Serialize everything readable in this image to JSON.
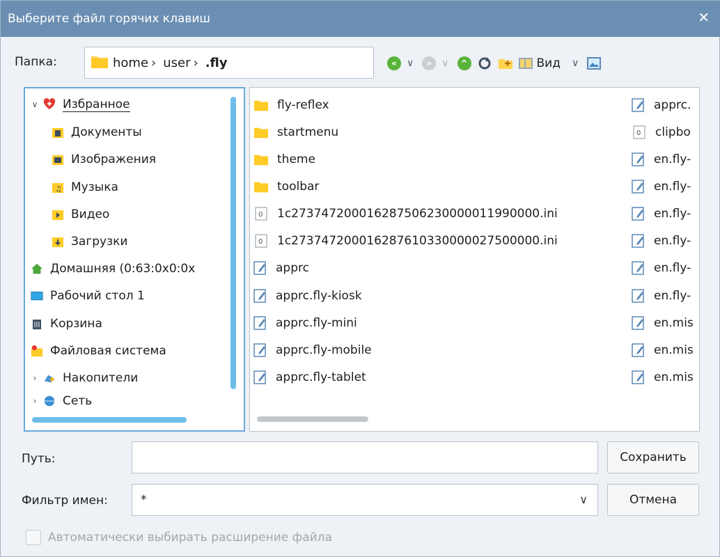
{
  "window": {
    "title": "Выберите файл горячих клавиш",
    "close_icon": "close-icon"
  },
  "location": {
    "label": "Папка:",
    "breadcrumbs": [
      "home",
      "user",
      ".fly"
    ]
  },
  "toolbar": {
    "view_label": "Вид"
  },
  "sidebar": {
    "items": [
      {
        "label": "Избранное"
      },
      {
        "label": "Документы"
      },
      {
        "label": "Изображения"
      },
      {
        "label": "Музыка"
      },
      {
        "label": "Видео"
      },
      {
        "label": "Загрузки"
      },
      {
        "label": "Домашняя (0:63:0x0:0x"
      },
      {
        "label": "Рабочий стол 1"
      },
      {
        "label": "Корзина"
      },
      {
        "label": "Файловая система"
      },
      {
        "label": "Накопители"
      },
      {
        "label": "Сеть"
      }
    ]
  },
  "files": {
    "col1": [
      {
        "name": "fly-reflex"
      },
      {
        "name": "startmenu"
      },
      {
        "name": "theme"
      },
      {
        "name": "toolbar"
      },
      {
        "name": "1c273747200016287506230000011990000.ini"
      },
      {
        "name": "1c273747200016287610330000027500000.ini"
      },
      {
        "name": "apprc"
      },
      {
        "name": "apprc.fly-kiosk"
      },
      {
        "name": "apprc.fly-mini"
      },
      {
        "name": "apprc.fly-mobile"
      },
      {
        "name": "apprc.fly-tablet"
      }
    ],
    "col2": [
      {
        "name": "apprc."
      },
      {
        "name": "clipbo"
      },
      {
        "name": "en.fly-"
      },
      {
        "name": "en.fly-"
      },
      {
        "name": "en.fly-"
      },
      {
        "name": "en.fly-"
      },
      {
        "name": "en.fly-"
      },
      {
        "name": "en.fly-"
      },
      {
        "name": "en.mis"
      },
      {
        "name": "en.mis"
      },
      {
        "name": "en.mis"
      }
    ]
  },
  "path": {
    "label": "Путь:",
    "value": ""
  },
  "buttons": {
    "save": "Сохранить",
    "cancel": "Отмена"
  },
  "filter": {
    "label": "Фильтр имен:",
    "value": "*"
  },
  "auto_extension": {
    "label": "Автоматически выбирать расширение файла",
    "checked": false
  }
}
